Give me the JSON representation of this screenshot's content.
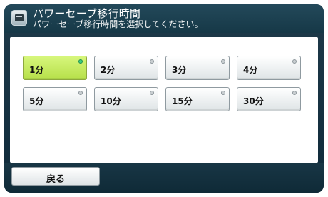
{
  "header": {
    "title": "パワーセーブ移行時間",
    "subtitle": "パワーセーブ移行時間を選択してください。",
    "icon": "machine-settings-icon"
  },
  "options": [
    {
      "label": "1分",
      "selected": true
    },
    {
      "label": "2分",
      "selected": false
    },
    {
      "label": "3分",
      "selected": false
    },
    {
      "label": "4分",
      "selected": false
    },
    {
      "label": "5分",
      "selected": false
    },
    {
      "label": "10分",
      "selected": false
    },
    {
      "label": "15分",
      "selected": false
    },
    {
      "label": "30分",
      "selected": false
    }
  ],
  "footer": {
    "back_label": "戻る"
  },
  "colors": {
    "selected_fill": "#C6EE62",
    "selected_led": "#3FCF7F",
    "header_bg": "#163847"
  }
}
